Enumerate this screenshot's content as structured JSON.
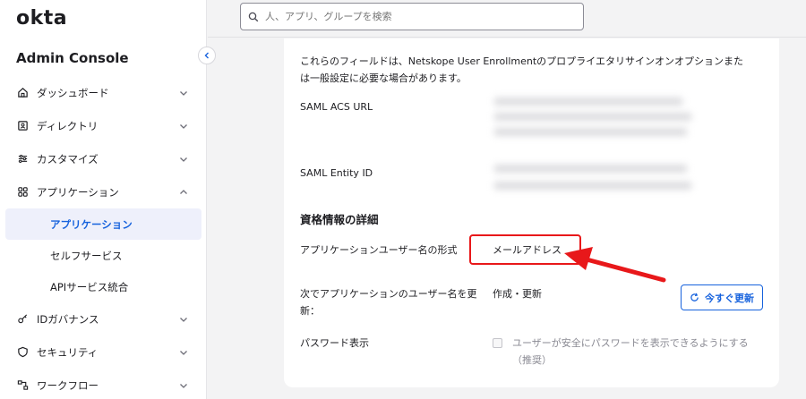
{
  "brand": {
    "logo": "okta",
    "console_title": "Admin Console"
  },
  "search": {
    "placeholder": "人、アプリ、グループを検索"
  },
  "sidebar": {
    "items": [
      {
        "label": "ダッシュボード",
        "icon": "home-icon"
      },
      {
        "label": "ディレクトリ",
        "icon": "directory-icon"
      },
      {
        "label": "カスタマイズ",
        "icon": "customize-icon"
      },
      {
        "label": "アプリケーション",
        "icon": "apps-grid-icon",
        "expanded": true
      },
      {
        "label": "IDガバナンス",
        "icon": "key-icon"
      },
      {
        "label": "セキュリティ",
        "icon": "shield-icon"
      },
      {
        "label": "ワークフロー",
        "icon": "workflow-icon"
      }
    ],
    "sub_items": [
      "アプリケーション",
      "セルフサービス",
      "APIサービス統合"
    ],
    "active_sub_item": "アプリケーション"
  },
  "content": {
    "description": "これらのフィールドは、Netskope User Enrollmentのプロプライエタリサインオンオプションまたは一般設定に必要な場合があります。",
    "saml_acs_url_label": "SAML ACS URL",
    "saml_entity_id_label": "SAML Entity ID",
    "credentials_title": "資格情報の詳細",
    "username_format_label": "アプリケーションユーザー名の形式",
    "username_format_value": "メールアドレス",
    "update_label": "次でアプリケーションのユーザー名を更新：",
    "update_value": "作成・更新",
    "update_now_button": "今すぐ更新",
    "password_reveal_label": "パスワード表示",
    "password_reveal_checkbox": "ユーザーが安全にパスワードを表示できるようにする（推奨）",
    "password_reveal_checked": false
  },
  "colors": {
    "accent": "#1662dd",
    "annotation": "#e8181a"
  }
}
